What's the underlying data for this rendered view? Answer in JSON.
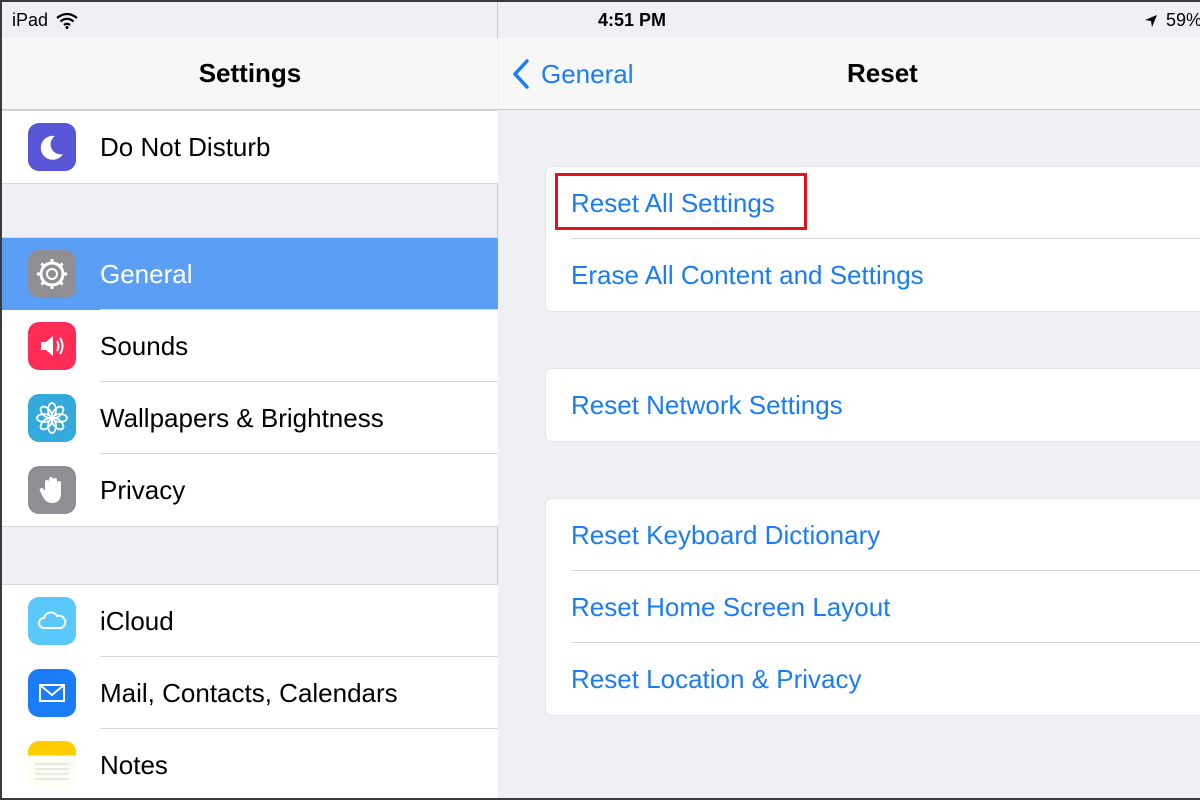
{
  "status_bar": {
    "device": "iPad",
    "time": "4:51 PM",
    "battery": "59%"
  },
  "sidebar": {
    "title": "Settings",
    "groups": [
      {
        "items": [
          {
            "label": "Do Not Disturb",
            "icon": "moon-icon",
            "color": "#5856d6"
          }
        ]
      },
      {
        "items": [
          {
            "label": "General",
            "icon": "gear-icon",
            "color": "#8e8e93",
            "selected": true
          },
          {
            "label": "Sounds",
            "icon": "speaker-icon",
            "color": "#ff2d55"
          },
          {
            "label": "Wallpapers & Brightness",
            "icon": "flower-icon",
            "color": "#34aadc"
          },
          {
            "label": "Privacy",
            "icon": "hand-icon",
            "color": "#8e8e93"
          }
        ]
      },
      {
        "items": [
          {
            "label": "iCloud",
            "icon": "cloud-icon",
            "color": "#5ac8fa"
          },
          {
            "label": "Mail, Contacts, Calendars",
            "icon": "envelope-icon",
            "color": "#1a7cf6"
          },
          {
            "label": "Notes",
            "icon": "notepad-icon",
            "color": "#ffcc00"
          }
        ]
      }
    ]
  },
  "detail": {
    "back_label": "General",
    "title": "Reset",
    "groups": [
      {
        "items": [
          {
            "label": "Reset All Settings"
          },
          {
            "label": "Erase All Content and Settings"
          }
        ]
      },
      {
        "items": [
          {
            "label": "Reset Network Settings"
          }
        ]
      },
      {
        "items": [
          {
            "label": "Reset Keyboard Dictionary"
          },
          {
            "label": "Reset Home Screen Layout"
          },
          {
            "label": "Reset Location & Privacy"
          }
        ]
      }
    ]
  },
  "colors": {
    "accent": "#1a7cf6",
    "selection": "#5a9ef6",
    "highlight": "#e0141e"
  }
}
